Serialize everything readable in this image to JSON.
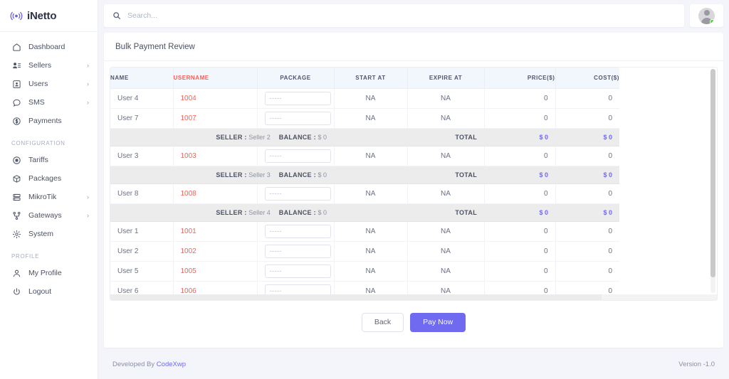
{
  "brand": {
    "name": "iNetto",
    "icon": "broadcast-icon",
    "accent": "#6a61e8"
  },
  "sidebar": {
    "items": [
      {
        "label": "Dashboard",
        "icon": "home-icon",
        "caret": ""
      },
      {
        "label": "Sellers",
        "icon": "users-list-icon",
        "caret": "›"
      },
      {
        "label": "Users",
        "icon": "user-box-icon",
        "caret": "›"
      },
      {
        "label": "SMS",
        "icon": "chat-icon",
        "caret": "›"
      },
      {
        "label": "Payments",
        "icon": "dollar-circle-icon",
        "caret": ""
      }
    ],
    "section_configuration": "CONFIGURATION",
    "config_items": [
      {
        "label": "Tariffs",
        "icon": "tariff-icon",
        "caret": ""
      },
      {
        "label": "Packages",
        "icon": "box-icon",
        "caret": ""
      },
      {
        "label": "MikroTik",
        "icon": "server-icon",
        "caret": "›"
      },
      {
        "label": "Gateways",
        "icon": "gateway-icon",
        "caret": "›"
      },
      {
        "label": "System",
        "icon": "gear-icon",
        "caret": ""
      }
    ],
    "section_profile": "PROFILE",
    "profile_items": [
      {
        "label": "My Profile",
        "icon": "person-icon",
        "caret": ""
      },
      {
        "label": "Logout",
        "icon": "power-icon",
        "caret": ""
      }
    ]
  },
  "search": {
    "placeholder": "Search...",
    "value": ""
  },
  "card": {
    "title": "Bulk Payment Review"
  },
  "table": {
    "headers": [
      "NAME",
      "USERNAME",
      "PACKAGE",
      "START AT",
      "EXPIRE AT",
      "PRICE($)",
      "COST($)"
    ],
    "package_placeholder": "-----",
    "seller_label": "SELLER :",
    "balance_label": "BALANCE :",
    "total_label": "TOTAL",
    "rows": [
      {
        "kind": "user",
        "name": "User 4",
        "username": "1004",
        "package": "-----",
        "start": "NA",
        "expire": "NA",
        "price": "0",
        "cost": "0"
      },
      {
        "kind": "user",
        "name": "User 7",
        "username": "1007",
        "package": "-----",
        "start": "NA",
        "expire": "NA",
        "price": "0",
        "cost": "0"
      },
      {
        "kind": "seller",
        "seller": "Seller 2",
        "balance": "$ 0",
        "total_price": "$ 0",
        "total_cost": "$ 0"
      },
      {
        "kind": "user",
        "name": "User 3",
        "username": "1003",
        "package": "-----",
        "start": "NA",
        "expire": "NA",
        "price": "0",
        "cost": "0"
      },
      {
        "kind": "seller",
        "seller": "Seller 3",
        "balance": "$ 0",
        "total_price": "$ 0",
        "total_cost": "$ 0"
      },
      {
        "kind": "user",
        "name": "User 8",
        "username": "1008",
        "package": "-----",
        "start": "NA",
        "expire": "NA",
        "price": "0",
        "cost": "0"
      },
      {
        "kind": "seller",
        "seller": "Seller 4",
        "balance": "$ 0",
        "total_price": "$ 0",
        "total_cost": "$ 0"
      },
      {
        "kind": "user",
        "name": "User 1",
        "username": "1001",
        "package": "-----",
        "start": "NA",
        "expire": "NA",
        "price": "0",
        "cost": "0"
      },
      {
        "kind": "user",
        "name": "User 2",
        "username": "1002",
        "package": "-----",
        "start": "NA",
        "expire": "NA",
        "price": "0",
        "cost": "0"
      },
      {
        "kind": "user",
        "name": "User 5",
        "username": "1005",
        "package": "-----",
        "start": "NA",
        "expire": "NA",
        "price": "0",
        "cost": "0"
      },
      {
        "kind": "user",
        "name": "User 6",
        "username": "1006",
        "package": "-----",
        "start": "NA",
        "expire": "NA",
        "price": "0",
        "cost": "0"
      }
    ]
  },
  "actions": {
    "back": "Back",
    "pay": "Pay Now"
  },
  "footer": {
    "developed_by": "Developed By",
    "developer": "CodeXwp",
    "version": "Version -1.0"
  },
  "colors": {
    "accent": "#6f6af0",
    "username": "#f76055",
    "header_bg": "#f2f7fe",
    "seller_row_bg": "#ececec",
    "status_online": "#4cd137"
  }
}
